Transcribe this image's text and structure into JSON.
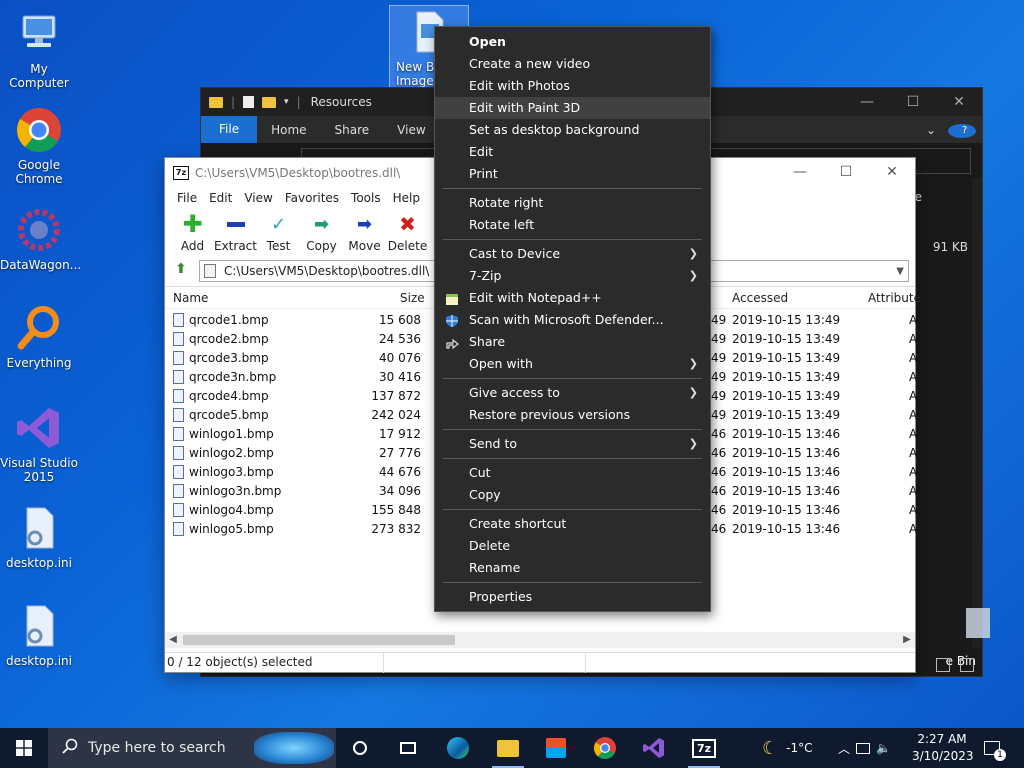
{
  "desktop": {
    "icons": [
      {
        "label": "My Computer"
      },
      {
        "label": "Google Chrome"
      },
      {
        "label": "DataWagon..."
      },
      {
        "label": "Everything"
      },
      {
        "label": "Visual Studio 2015"
      },
      {
        "label": "desktop.ini"
      },
      {
        "label": "desktop.ini"
      },
      {
        "label": "New Bi... Image..."
      }
    ]
  },
  "explorer": {
    "title": "Resources",
    "ribbon": [
      "File",
      "Home",
      "Share",
      "View"
    ],
    "size_value": "91 KB",
    "bin_label": "e Bin",
    "column_fragment": "e"
  },
  "sevenzip": {
    "title": "C:\\Users\\VM5\\Desktop\\bootres.dll\\",
    "menu": [
      "File",
      "Edit",
      "View",
      "Favorites",
      "Tools",
      "Help"
    ],
    "toolbar": [
      "Add",
      "Extract",
      "Test",
      "Copy",
      "Move",
      "Delete"
    ],
    "address": "C:\\Users\\VM5\\Desktop\\bootres.dll\\",
    "columns": {
      "name": "Name",
      "size": "Size",
      "accessed": "Accessed",
      "attributes": "Attribute"
    },
    "files": [
      {
        "name": "qrcode1.bmp",
        "size": "15 608",
        "m": "49",
        "accessed": "2019-10-15 13:49",
        "attr": "A"
      },
      {
        "name": "qrcode2.bmp",
        "size": "24 536",
        "m": "49",
        "accessed": "2019-10-15 13:49",
        "attr": "A"
      },
      {
        "name": "qrcode3.bmp",
        "size": "40 076",
        "m": "49",
        "accessed": "2019-10-15 13:49",
        "attr": "A"
      },
      {
        "name": "qrcode3n.bmp",
        "size": "30 416",
        "m": "49",
        "accessed": "2019-10-15 13:49",
        "attr": "A"
      },
      {
        "name": "qrcode4.bmp",
        "size": "137 872",
        "m": "49",
        "accessed": "2019-10-15 13:49",
        "attr": "A"
      },
      {
        "name": "qrcode5.bmp",
        "size": "242 024",
        "m": "49",
        "accessed": "2019-10-15 13:49",
        "attr": "A"
      },
      {
        "name": "winlogo1.bmp",
        "size": "17 912",
        "m": "46",
        "accessed": "2019-10-15 13:46",
        "attr": "A"
      },
      {
        "name": "winlogo2.bmp",
        "size": "27 776",
        "m": "46",
        "accessed": "2019-10-15 13:46",
        "attr": "A"
      },
      {
        "name": "winlogo3.bmp",
        "size": "44 676",
        "m": "46",
        "accessed": "2019-10-15 13:46",
        "attr": "A"
      },
      {
        "name": "winlogo3n.bmp",
        "size": "34 096",
        "m": "46",
        "accessed": "2019-10-15 13:46",
        "attr": "A"
      },
      {
        "name": "winlogo4.bmp",
        "size": "155 848",
        "m": "46",
        "accessed": "2019-10-15 13:46",
        "attr": "A"
      },
      {
        "name": "winlogo5.bmp",
        "size": "273 832",
        "m": "46",
        "accessed": "2019-10-15 13:46",
        "attr": "A"
      }
    ],
    "status": "0 / 12 object(s) selected"
  },
  "context_menu": {
    "items": [
      {
        "label": "Open",
        "bold": true
      },
      {
        "label": "Create a new video"
      },
      {
        "label": "Edit with Photos"
      },
      {
        "label": "Edit with Paint 3D",
        "hover": true
      },
      {
        "label": "Set as desktop background"
      },
      {
        "label": "Edit"
      },
      {
        "label": "Print"
      },
      {
        "label": "Rotate right"
      },
      {
        "label": "Rotate left"
      },
      {
        "label": "Cast to Device",
        "submenu": true
      },
      {
        "label": "7-Zip",
        "submenu": true
      },
      {
        "label": "Edit with Notepad++",
        "icon": "notepad-icon"
      },
      {
        "label": "Scan with Microsoft Defender...",
        "icon": "defender-shield-icon"
      },
      {
        "label": "Share",
        "icon": "share-icon"
      },
      {
        "label": "Open with",
        "submenu": true
      },
      {
        "label": "Give access to",
        "submenu": true
      },
      {
        "label": "Restore previous versions"
      },
      {
        "label": "Send to",
        "submenu": true
      },
      {
        "label": "Cut"
      },
      {
        "label": "Copy"
      },
      {
        "label": "Create shortcut"
      },
      {
        "label": "Delete"
      },
      {
        "label": "Rename"
      },
      {
        "label": "Properties"
      }
    ]
  },
  "taskbar": {
    "search_placeholder": "Type here to search",
    "weather": "-1°C",
    "time": "2:27 AM",
    "date": "3/10/2023",
    "notification_count": "1"
  },
  "colors": {
    "accent": "#1a6fd1",
    "menu_bg": "#2b2b2b",
    "taskbar_bg": "#0f1a2e"
  }
}
